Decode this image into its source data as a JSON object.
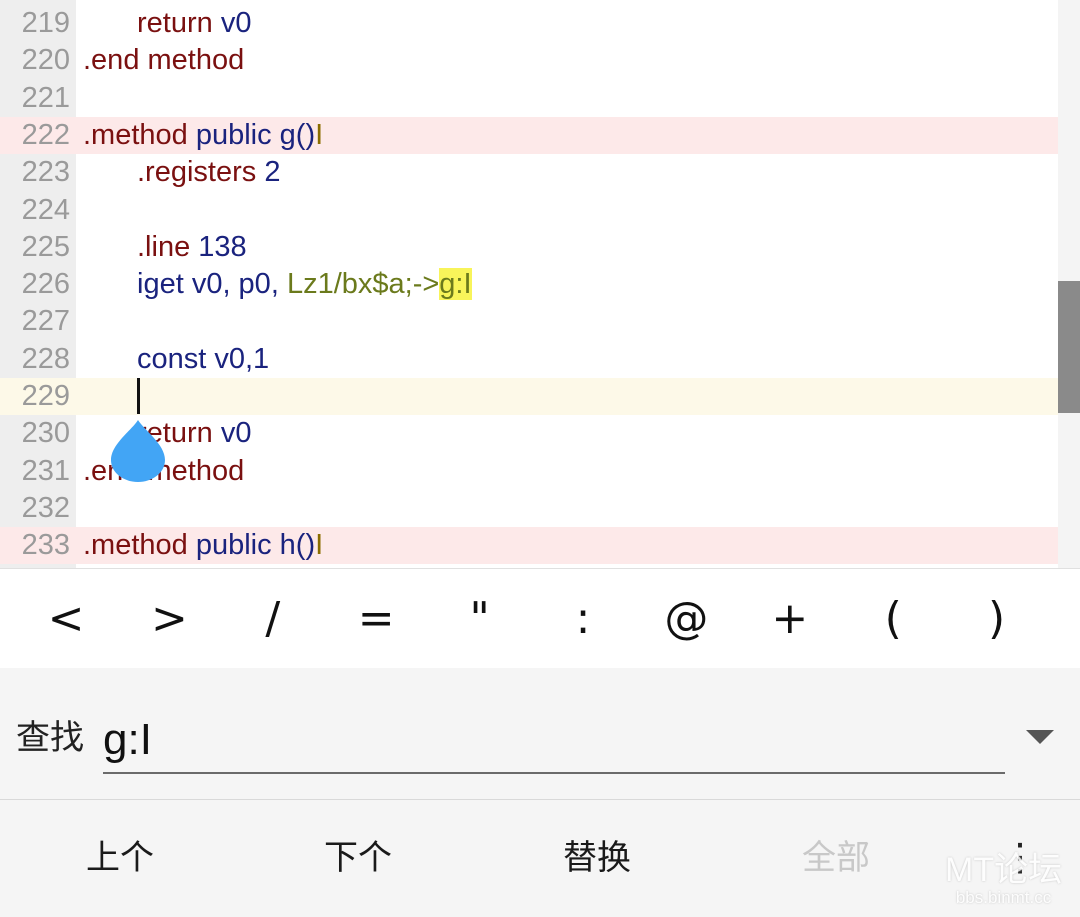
{
  "editor": {
    "lines": [
      {
        "no": "219",
        "parts": [
          {
            "t": "    ",
            "c": "ind"
          },
          {
            "t": "return",
            "c": "c-dir"
          },
          {
            "t": " v0",
            "c": "c-kw"
          }
        ]
      },
      {
        "no": "220",
        "parts": [
          {
            "t": ".end method",
            "c": "c-dir"
          }
        ]
      },
      {
        "no": "221",
        "parts": []
      },
      {
        "no": "222",
        "parts": [
          {
            "t": ".method",
            "c": "c-dir"
          },
          {
            "t": " public g()",
            "c": "c-kw"
          },
          {
            "t": "I",
            "c": "c-type"
          }
        ]
      },
      {
        "no": "223",
        "parts": [
          {
            "t": "    ",
            "c": "ind"
          },
          {
            "t": ".registers",
            "c": "c-dir"
          },
          {
            "t": " 2",
            "c": "c-kw"
          }
        ]
      },
      {
        "no": "224",
        "parts": []
      },
      {
        "no": "225",
        "parts": [
          {
            "t": "    ",
            "c": "ind"
          },
          {
            "t": ".line",
            "c": "c-dir"
          },
          {
            "t": " 138",
            "c": "c-kw"
          }
        ]
      },
      {
        "no": "226",
        "parts": [
          {
            "t": "    ",
            "c": "ind"
          },
          {
            "t": "iget v0, p0, ",
            "c": "c-kw"
          },
          {
            "t": "Lz1/bx$a;->",
            "c": "c-class"
          },
          {
            "t": "g:I",
            "c": "c-match"
          }
        ]
      },
      {
        "no": "227",
        "parts": []
      },
      {
        "no": "228",
        "parts": [
          {
            "t": "    ",
            "c": "ind"
          },
          {
            "t": "const v0,1",
            "c": "c-kw"
          }
        ]
      },
      {
        "no": "229",
        "parts": []
      },
      {
        "no": "230",
        "parts": [
          {
            "t": "    ",
            "c": "ind"
          },
          {
            "t": "return",
            "c": "c-dir"
          },
          {
            "t": " v0",
            "c": "c-kw"
          }
        ]
      },
      {
        "no": "231",
        "parts": [
          {
            "t": ".end method",
            "c": "c-dir"
          }
        ]
      },
      {
        "no": "232",
        "parts": []
      },
      {
        "no": "233",
        "parts": [
          {
            "t": ".method",
            "c": "c-dir"
          },
          {
            "t": " public h()",
            "c": "c-kw"
          },
          {
            "t": "I",
            "c": "c-type"
          }
        ]
      }
    ],
    "method_lines": [
      "222",
      "233"
    ],
    "cursor_line": "229"
  },
  "symbols": [
    "<",
    ">",
    "/",
    "=",
    "\"",
    ":",
    "@",
    "+",
    "(",
    ")",
    ";"
  ],
  "find": {
    "label": "查找",
    "value": "g:I",
    "dropdown_icon": "triangle-down"
  },
  "actions": {
    "prev": "上个",
    "next": "下个",
    "replace": "替换",
    "all": "全部",
    "more": "⋮"
  },
  "watermark": {
    "title": "MT论坛",
    "url": "bbs.binmt.cc"
  },
  "colors": {
    "directive": "#7a1010",
    "keyword": "#1a237e",
    "match_highlight": "#f8f45a",
    "method_line_bg": "#fde9e9",
    "cursor_line_bg": "#fdf9e8",
    "handle": "#42a5f5"
  }
}
